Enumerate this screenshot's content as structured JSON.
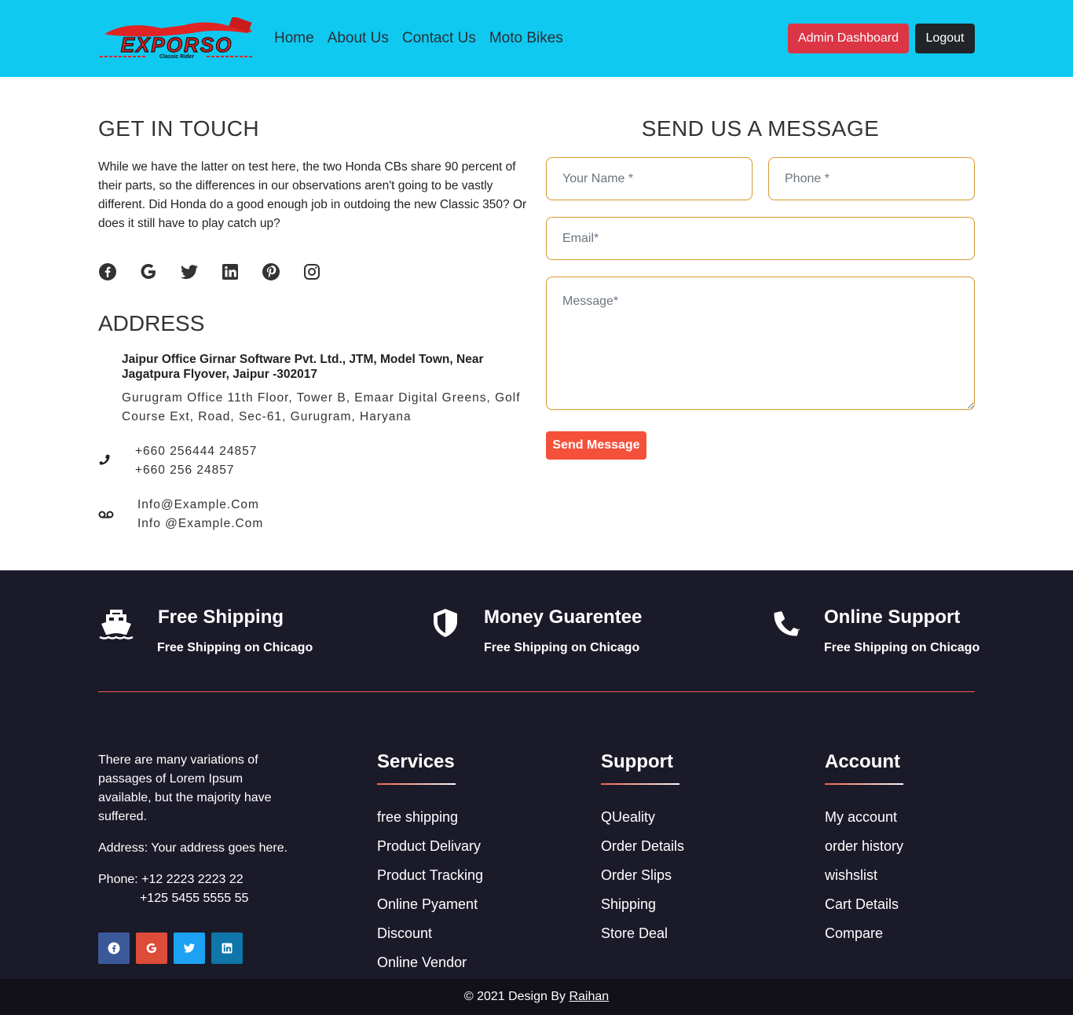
{
  "header": {
    "logo_text": "EXPORSO",
    "logo_tagline": "Classic Rider",
    "nav": [
      "Home",
      "About Us",
      "Contact Us",
      "Moto Bikes"
    ],
    "admin_label": "Admin Dashboard",
    "logout_label": "Logout",
    "colors": {
      "bar": "#10c9f0",
      "admin": "#dc3545",
      "logout": "#212529"
    }
  },
  "contact": {
    "title": "GET IN TOUCH",
    "text": "While we have the latter on test here, the two Honda CBs share 90 percent of their parts, so the differences in our observations aren't going to be vastly different. Did Honda do a good enough job in outdoing the new Classic 350? Or does it still have to play catch up?",
    "social_icons": [
      "facebook-icon",
      "google-icon",
      "twitter-icon",
      "linkedin-icon",
      "pinterest-icon",
      "instagram-icon"
    ],
    "address_title": "ADDRESS",
    "office1": "Jaipur Office Girnar Software Pvt. Ltd., JTM, Model Town, Near Jagatpura Flyover, Jaipur -302017",
    "office2": "Gurugram Office 11th Floor, Tower B, Emaar Digital Greens, Golf Course Ext, Road, Sec-61, Gurugram, Haryana",
    "phone1": "+660 256444 24857",
    "phone2": "+660 256 24857",
    "email1": "Info@Example.Com",
    "email2": "Info @Example.Com"
  },
  "form": {
    "title": "SEND US A MESSAGE",
    "name_placeholder": "Your Name *",
    "phone_placeholder": "Phone *",
    "email_placeholder": "Email*",
    "message_placeholder": "Message*",
    "submit_label": "Send Message",
    "border_color": "#d69a2d",
    "button_color": "#f5513a"
  },
  "features": [
    {
      "icon": "ship-icon",
      "title": "Free Shipping",
      "subtitle": "Free Shipping on Chicago"
    },
    {
      "icon": "shield-icon",
      "title": "Money Guarentee",
      "subtitle": "Free Shipping on Chicago"
    },
    {
      "icon": "phone-icon",
      "title": "Online Support",
      "subtitle": "Free Shipping on Chicago"
    }
  ],
  "footer": {
    "about": "There are many variations of passages of Lorem Ipsum available, but the majority have suffered.",
    "address": "Address: Your address goes here.",
    "phone_line1": "Phone: +12 2223 2223 22",
    "phone_line2": "+125 5455 5555 55",
    "social_icons": [
      "facebook-icon",
      "google-icon",
      "twitter-icon",
      "linkedin-icon"
    ],
    "columns": [
      {
        "title": "Services",
        "items": [
          "free shipping",
          "Product Delivary",
          "Product Tracking",
          "Online Pyament",
          "Discount",
          "Online Vendor"
        ]
      },
      {
        "title": "Support",
        "items": [
          "QUeality",
          "Order Details",
          "Order Slips",
          "Shipping",
          "Store Deal"
        ]
      },
      {
        "title": "Account",
        "items": [
          "My account",
          "order history",
          "wishslist",
          "Cart Details",
          "Compare"
        ]
      }
    ],
    "copyright_prefix": "© 2021 Design By ",
    "copyright_author": "Raihan",
    "bg_color": "#1b1a29"
  }
}
